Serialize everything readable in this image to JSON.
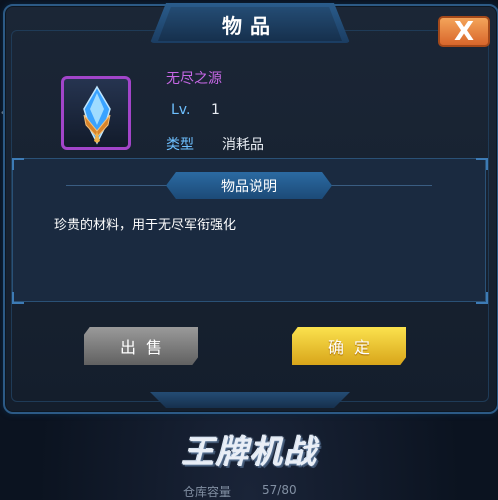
{
  "dialog": {
    "title": "物品",
    "close_label": "X"
  },
  "item": {
    "icon": "blue-crystal-icon",
    "name": "无尽之源",
    "lv_label": "Lv.",
    "lv_value": "1",
    "type_label": "类型",
    "type_value": "消耗品",
    "rarity_color": "#a245c9"
  },
  "description": {
    "header": "物品说明",
    "text": "珍贵的材料，用于无尽军衔强化"
  },
  "buttons": {
    "sell_label": "出售",
    "confirm_label": "确定"
  },
  "footer": {
    "logo_text": "王牌机战",
    "capacity_label": "仓库容量",
    "capacity_value": "57/80"
  },
  "background": {
    "dots": "•••"
  }
}
